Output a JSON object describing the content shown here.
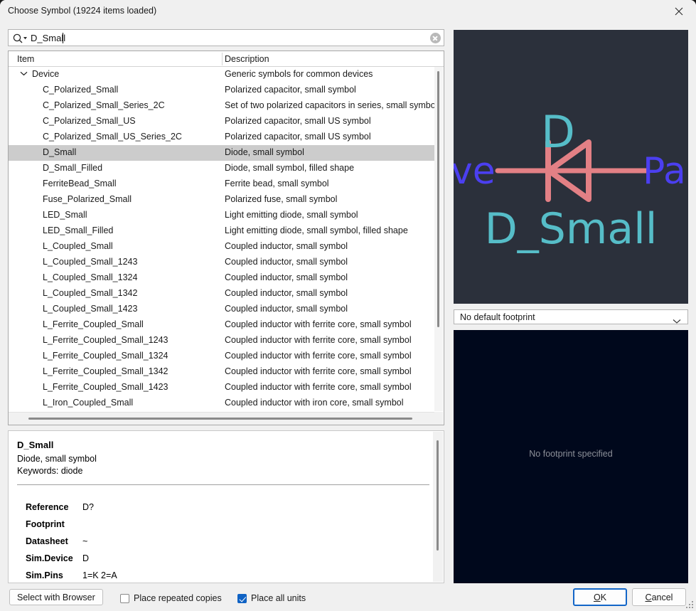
{
  "window": {
    "title": "Choose Symbol (19224 items loaded)",
    "close_icon": "close-icon"
  },
  "search": {
    "value": "D_Small",
    "icon": "search-icon",
    "clear_icon": "clear-icon"
  },
  "list": {
    "columns": [
      "Item",
      "Description"
    ],
    "rows": [
      {
        "item": "Device",
        "desc": "Generic symbols for common devices",
        "depth": 0,
        "expanded": true,
        "selected": false
      },
      {
        "item": "C_Polarized_Small",
        "desc": "Polarized capacitor, small symbol",
        "depth": 1,
        "selected": false
      },
      {
        "item": "C_Polarized_Small_Series_2C",
        "desc": "Set of two polarized capacitors in series, small symbol",
        "depth": 1,
        "selected": false
      },
      {
        "item": "C_Polarized_Small_US",
        "desc": "Polarized capacitor, small US symbol",
        "depth": 1,
        "selected": false
      },
      {
        "item": "C_Polarized_Small_US_Series_2C",
        "desc": "Polarized capacitor, small US symbol",
        "depth": 1,
        "selected": false
      },
      {
        "item": "D_Small",
        "desc": "Diode, small symbol",
        "depth": 1,
        "selected": true
      },
      {
        "item": "D_Small_Filled",
        "desc": "Diode, small symbol, filled shape",
        "depth": 1,
        "selected": false
      },
      {
        "item": "FerriteBead_Small",
        "desc": "Ferrite bead, small symbol",
        "depth": 1,
        "selected": false
      },
      {
        "item": "Fuse_Polarized_Small",
        "desc": "Polarized fuse, small symbol",
        "depth": 1,
        "selected": false
      },
      {
        "item": "LED_Small",
        "desc": "Light emitting diode, small symbol",
        "depth": 1,
        "selected": false
      },
      {
        "item": "LED_Small_Filled",
        "desc": "Light emitting diode, small symbol, filled shape",
        "depth": 1,
        "selected": false
      },
      {
        "item": "L_Coupled_Small",
        "desc": "Coupled inductor, small symbol",
        "depth": 1,
        "selected": false
      },
      {
        "item": "L_Coupled_Small_1243",
        "desc": "Coupled inductor, small symbol",
        "depth": 1,
        "selected": false
      },
      {
        "item": "L_Coupled_Small_1324",
        "desc": "Coupled inductor, small symbol",
        "depth": 1,
        "selected": false
      },
      {
        "item": "L_Coupled_Small_1342",
        "desc": "Coupled inductor, small symbol",
        "depth": 1,
        "selected": false
      },
      {
        "item": "L_Coupled_Small_1423",
        "desc": "Coupled inductor, small symbol",
        "depth": 1,
        "selected": false
      },
      {
        "item": "L_Ferrite_Coupled_Small",
        "desc": "Coupled inductor with ferrite core, small symbol",
        "depth": 1,
        "selected": false
      },
      {
        "item": "L_Ferrite_Coupled_Small_1243",
        "desc": "Coupled inductor with ferrite core, small symbol",
        "depth": 1,
        "selected": false
      },
      {
        "item": "L_Ferrite_Coupled_Small_1324",
        "desc": "Coupled inductor with ferrite core, small symbol",
        "depth": 1,
        "selected": false
      },
      {
        "item": "L_Ferrite_Coupled_Small_1342",
        "desc": "Coupled inductor with ferrite core, small symbol",
        "depth": 1,
        "selected": false
      },
      {
        "item": "L_Ferrite_Coupled_Small_1423",
        "desc": "Coupled inductor with ferrite core, small symbol",
        "depth": 1,
        "selected": false
      },
      {
        "item": "L_Iron_Coupled_Small",
        "desc": "Coupled inductor with iron core, small symbol",
        "depth": 1,
        "selected": false
      }
    ]
  },
  "details": {
    "name": "D_Small",
    "description": "Diode, small symbol",
    "keywords": "Keywords: diode",
    "fields": [
      {
        "label": "Reference",
        "value": "D?"
      },
      {
        "label": "Footprint",
        "value": ""
      },
      {
        "label": "Datasheet",
        "value": "~"
      },
      {
        "label": "Sim.Device",
        "value": "D"
      },
      {
        "label": "Sim.Pins",
        "value": "1=K 2=A"
      }
    ]
  },
  "symbol_preview": {
    "ref_label": "D",
    "value_label": "D_Small",
    "left_fragment": "ve",
    "right_fragment": "Pa",
    "colors": {
      "background": "#2b303b",
      "symbol": "#e38085",
      "field_text": "#56bdc8",
      "side_text": "#4b3ff0"
    }
  },
  "footprint": {
    "combo_value": "No default footprint",
    "chevron_icon": "chevron-down-icon",
    "empty_text": "No footprint specified"
  },
  "bottom_bar": {
    "select_browser_label": "Select with Browser",
    "checkboxes": [
      {
        "label": "Place repeated copies",
        "checked": false
      },
      {
        "label": "Place all units",
        "checked": true
      }
    ],
    "ok_label": "OK",
    "ok_mnemonic": "O",
    "ok_rest": "K",
    "cancel_mnemonic": "C",
    "cancel_rest": "ancel"
  }
}
